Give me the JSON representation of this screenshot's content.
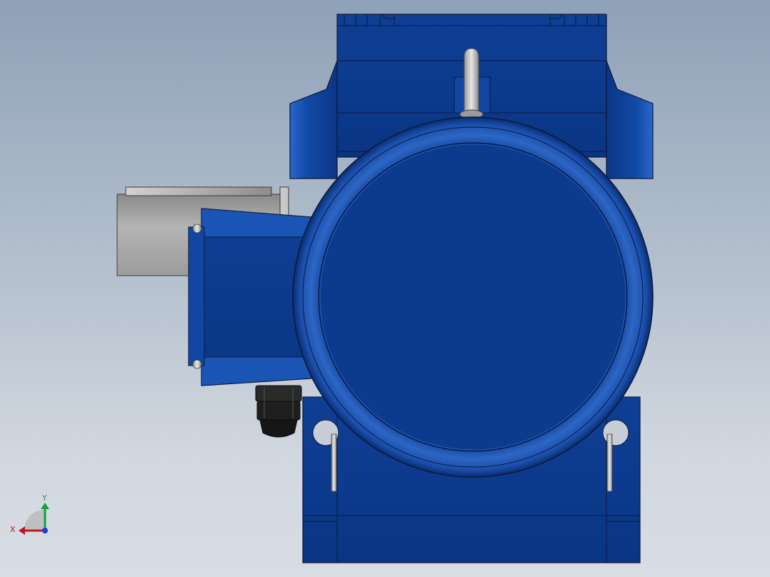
{
  "colors": {
    "background_top": "#8fa1b8",
    "background_bottom": "#d8dde4",
    "body_blue": "#0d3f96",
    "body_blue_light": "#2a67c9",
    "body_blue_dark": "#0a2e70",
    "outline": "#0a1a3a",
    "terminal_box_grey": "#a9a9a9",
    "gland_black": "#1c1c1c",
    "axis_x": "#c0141c",
    "axis_y": "#12a23a",
    "axis_z": "#1a3fd0"
  },
  "triad": {
    "x_label": "X",
    "y_label": "Y"
  }
}
